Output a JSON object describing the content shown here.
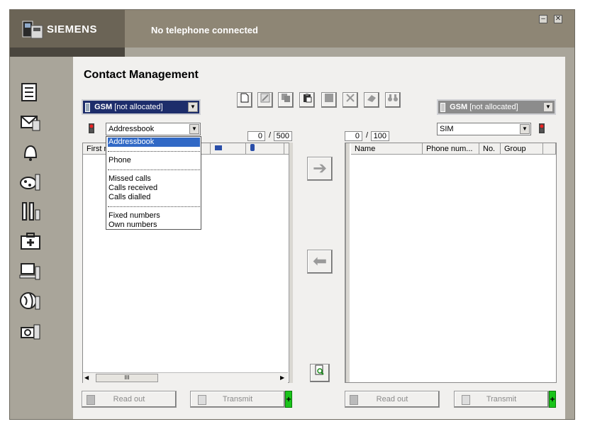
{
  "header": {
    "brand": "SIEMENS",
    "status": "No telephone connected",
    "min_glyph": "–",
    "close_glyph": "✕"
  },
  "page_title": "Contact Management",
  "left": {
    "source": {
      "main": "GSM",
      "sub": "[not allocated]"
    },
    "storage_selected": "Addressbook",
    "counter": {
      "current": "0",
      "slash": "/",
      "total": "500"
    },
    "columns": [
      "First n",
      "",
      ""
    ],
    "dropdown": {
      "items": [
        "Addressbook",
        "Phone",
        "Missed calls",
        "Calls received",
        "Calls dialled",
        "Fixed numbers",
        "Own numbers"
      ]
    },
    "scroll_thumb": "III"
  },
  "right": {
    "source": {
      "main": "GSM",
      "sub": "[not allocated]"
    },
    "storage_selected": "SIM",
    "counter": {
      "current": "0",
      "slash": "/",
      "total": "100"
    },
    "columns": [
      "Name",
      "Phone num...",
      "No.",
      "Group"
    ]
  },
  "buttons": {
    "read_out": "Read out",
    "transmit": "Transmit",
    "plus": "+"
  },
  "icons": {
    "arrow_right": "➔",
    "arrow_left": "⬅",
    "dd_arrow": "▼"
  },
  "colors": {
    "header_dark": "#6b6456",
    "header_mid": "#8e8675",
    "selection": "#3169c6",
    "plus_green": "#19c419"
  }
}
